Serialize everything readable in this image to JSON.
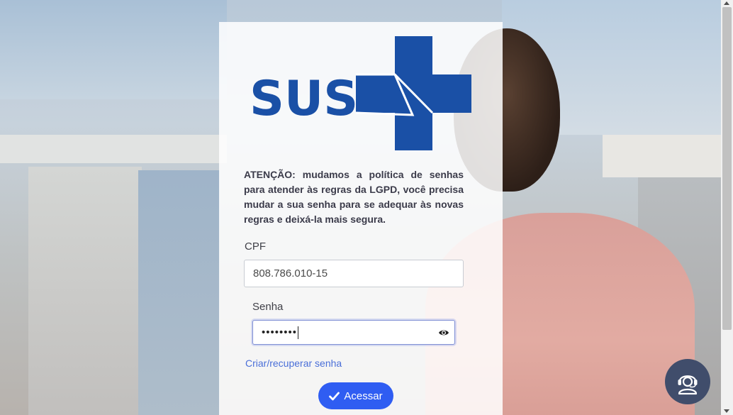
{
  "logo": {
    "text": "SUS",
    "color": "#1a50a6"
  },
  "warning": {
    "text": "ATENÇÃO: mudamos a política de senhas para atender às regras da LGPD, você precisa mudar a sua senha para se adequar às novas regras e deixá-la mais segura."
  },
  "form": {
    "cpf_label": "CPF",
    "cpf_value": "808.786.010-15",
    "senha_label": "Senha",
    "senha_value": "••••••••",
    "recover_link": "Criar/recuperar senha",
    "submit_label": "Acessar"
  },
  "icons": {
    "password_toggle": "eye-icon",
    "submit": "check-icon",
    "help": "support-agent-icon"
  },
  "colors": {
    "brand": "#1a50a6",
    "button": "#2f5df2",
    "link": "#4a6fd8",
    "help_button": "#404d6b"
  }
}
